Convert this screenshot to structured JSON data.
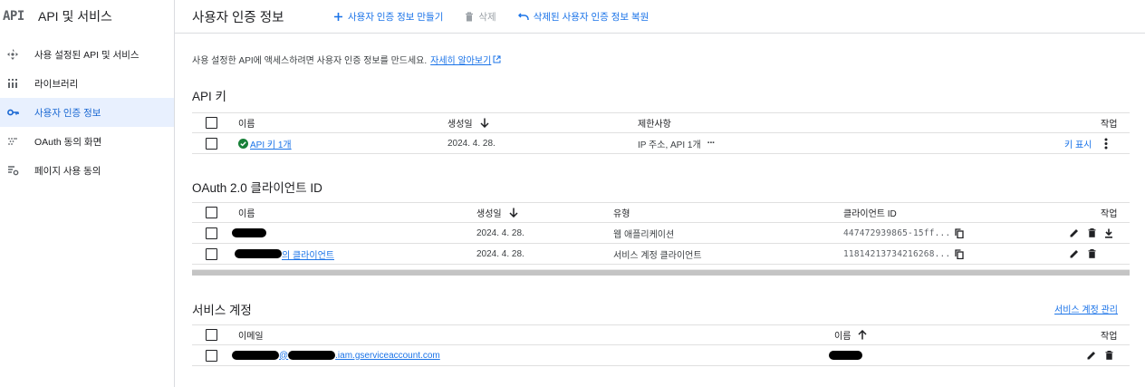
{
  "sidebar": {
    "logo_text": "API",
    "title": "API 및 서비스",
    "items": [
      {
        "label": "사용 설정된 API 및 서비스",
        "icon": "diamond-arrows-icon"
      },
      {
        "label": "라이브러리",
        "icon": "library-icon"
      },
      {
        "label": "사용자 인증 정보",
        "icon": "key-icon",
        "active": true
      },
      {
        "label": "OAuth 동의 화면",
        "icon": "dots-grid-icon"
      },
      {
        "label": "페이지 사용 동의",
        "icon": "settings-list-icon"
      }
    ]
  },
  "topbar": {
    "title": "사용자 인증 정보",
    "create_label": "사용자 인증 정보 만들기",
    "delete_label": "삭제",
    "restore_label": "삭제된 사용자 인증 정보 복원"
  },
  "info": {
    "text": "사용 설정한 API에 액세스하려면 사용자 인증 정보를 만드세요.",
    "link": "자세히 알아보기"
  },
  "api_keys": {
    "title": "API 키",
    "headers": {
      "name": "이름",
      "created": "생성일",
      "restrictions": "제한사항",
      "actions": "작업"
    },
    "rows": [
      {
        "name": "API 키 1개",
        "created": "2024. 4. 28.",
        "restrictions": "IP 주소, API 1개",
        "show_key": "키 표시"
      }
    ]
  },
  "oauth": {
    "title": "OAuth 2.0 클라이언트 ID",
    "headers": {
      "name": "이름",
      "created": "생성일",
      "type": "유형",
      "client_id": "클라이언트 ID",
      "actions": "작업"
    },
    "rows": [
      {
        "name_suffix": "",
        "created": "2024. 4. 28.",
        "type": "웹 애플리케이션",
        "client_id": "447472939865-15ff..."
      },
      {
        "name_suffix": "의 클라이언트",
        "created": "2024. 4. 28.",
        "type": "서비스 계정 클라이언트",
        "client_id": "11814213734216268..."
      }
    ]
  },
  "service_accounts": {
    "title": "서비스 계정",
    "manage_link": "서비스 계정 관리",
    "headers": {
      "email": "이메일",
      "name": "이름",
      "actions": "작업"
    },
    "rows": [
      {
        "email_at": "@",
        "email_domain": ".iam.gserviceaccount.com"
      }
    ]
  },
  "colors": {
    "accent": "#1a73e8",
    "active_bg": "#e8f0fe",
    "success": "#188038"
  }
}
